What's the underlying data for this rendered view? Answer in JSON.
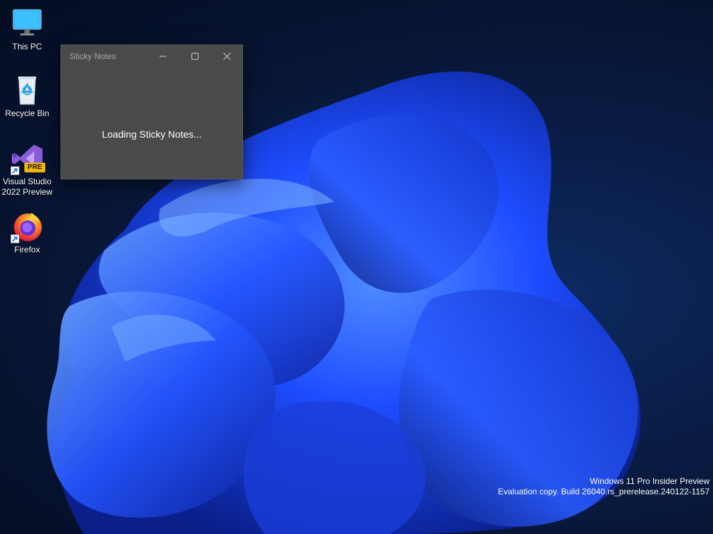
{
  "desktop": {
    "icons": [
      {
        "label": "This PC",
        "icon": "monitor-icon"
      },
      {
        "label": "Recycle Bin",
        "icon": "recycle-bin-icon"
      },
      {
        "label": "Visual Studio 2022 Preview",
        "icon": "visual-studio-icon",
        "badge": "PRE"
      },
      {
        "label": "Firefox",
        "icon": "firefox-icon"
      }
    ]
  },
  "sticky_notes_window": {
    "title": "Sticky Notes",
    "loading_message": "Loading Sticky Notes...",
    "controls": {
      "minimize": "minimize-icon",
      "maximize": "maximize-icon",
      "close": "close-icon"
    }
  },
  "watermark": {
    "line1": "Windows 11 Pro Insider Preview",
    "line2": "Evaluation copy. Build 26040.rs_prerelease.240122-1157"
  },
  "colors": {
    "window_bg": "#4a4a4a",
    "wallpaper_bg": "#071330",
    "bloom_blue": "#1f4fff"
  }
}
